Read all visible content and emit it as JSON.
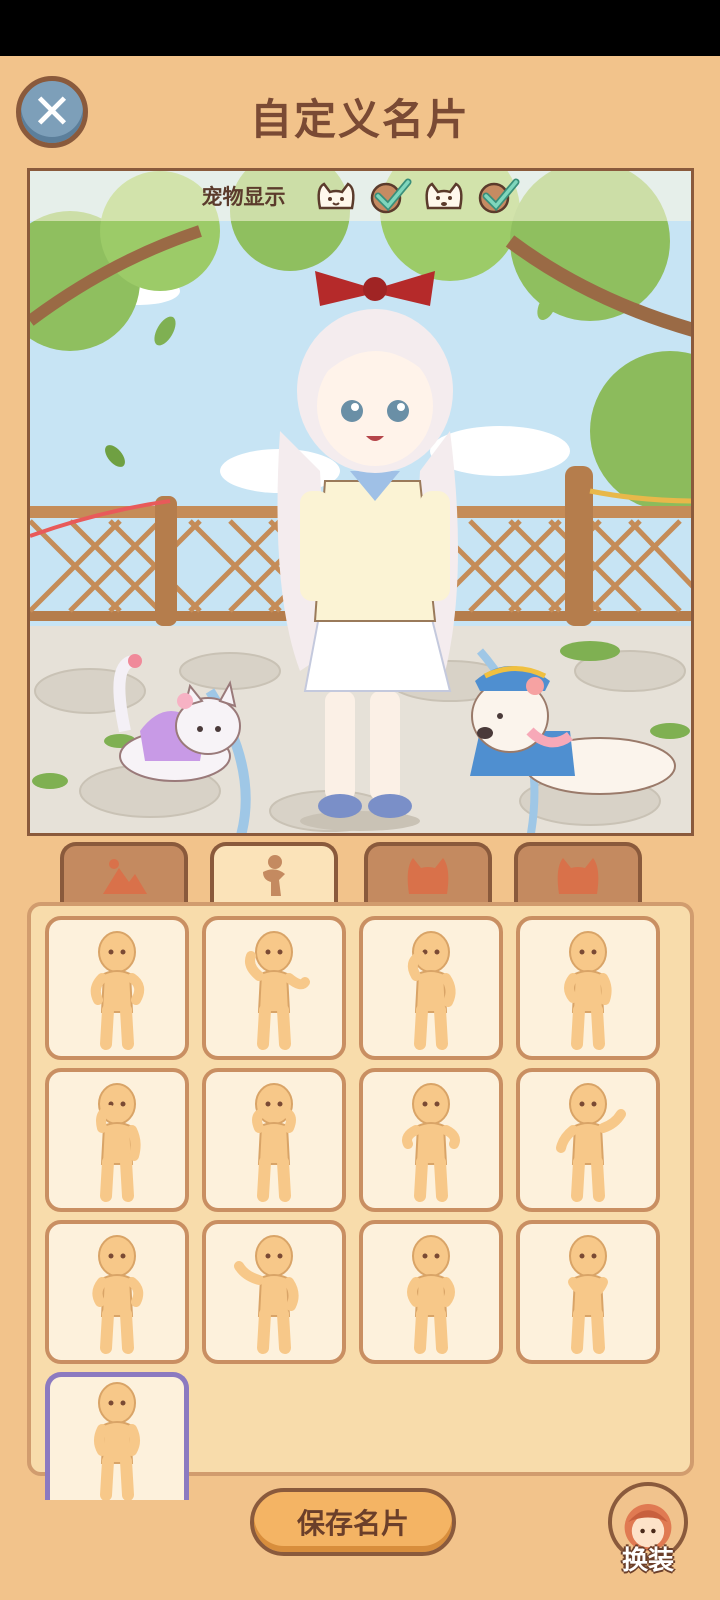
{
  "header": {
    "title": "自定义名片"
  },
  "pet_bar": {
    "label": "宠物显示",
    "pet1_checked": true,
    "pet2_checked": true
  },
  "tabs": [
    {
      "icon": "scenery-icon",
      "active": false
    },
    {
      "icon": "pose-icon",
      "active": true
    },
    {
      "icon": "cat-pet-icon",
      "active": false
    },
    {
      "icon": "cat-pet-icon",
      "active": false
    }
  ],
  "poses": {
    "count": 13,
    "selected_index": 12
  },
  "footer": {
    "save_label": "保存名片",
    "outfit_label": "换装"
  },
  "colors": {
    "background": "#f2c38b",
    "panel": "#f8dcab",
    "cell": "#fdf1dc",
    "selected_border": "#8c7ac0",
    "figure": "#f7c889"
  }
}
